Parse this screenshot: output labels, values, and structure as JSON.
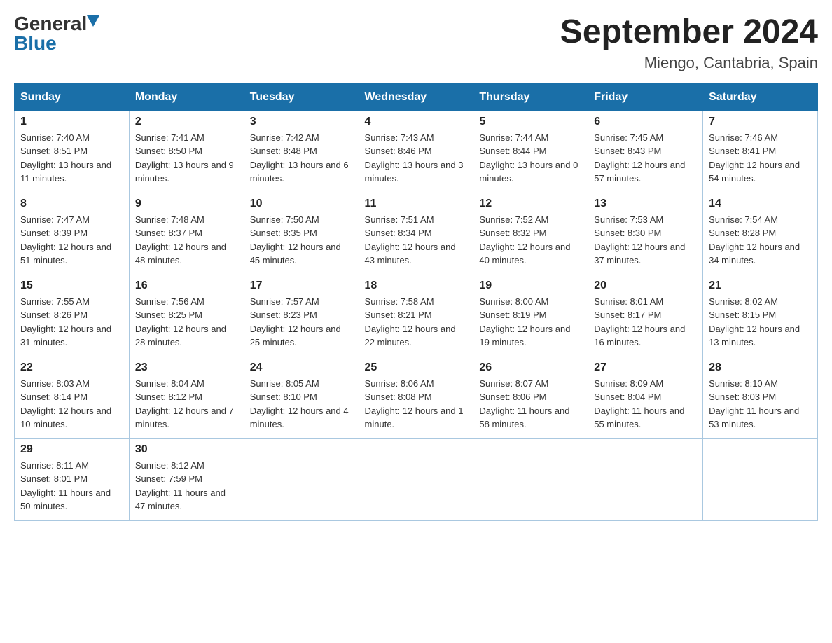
{
  "header": {
    "logo": {
      "general": "General",
      "blue": "Blue",
      "aria": "GeneralBlue logo"
    },
    "title": "September 2024",
    "location": "Miengo, Cantabria, Spain"
  },
  "calendar": {
    "days_of_week": [
      "Sunday",
      "Monday",
      "Tuesday",
      "Wednesday",
      "Thursday",
      "Friday",
      "Saturday"
    ],
    "weeks": [
      [
        {
          "day": "1",
          "sunrise": "7:40 AM",
          "sunset": "8:51 PM",
          "daylight": "13 hours and 11 minutes."
        },
        {
          "day": "2",
          "sunrise": "7:41 AM",
          "sunset": "8:50 PM",
          "daylight": "13 hours and 9 minutes."
        },
        {
          "day": "3",
          "sunrise": "7:42 AM",
          "sunset": "8:48 PM",
          "daylight": "13 hours and 6 minutes."
        },
        {
          "day": "4",
          "sunrise": "7:43 AM",
          "sunset": "8:46 PM",
          "daylight": "13 hours and 3 minutes."
        },
        {
          "day": "5",
          "sunrise": "7:44 AM",
          "sunset": "8:44 PM",
          "daylight": "13 hours and 0 minutes."
        },
        {
          "day": "6",
          "sunrise": "7:45 AM",
          "sunset": "8:43 PM",
          "daylight": "12 hours and 57 minutes."
        },
        {
          "day": "7",
          "sunrise": "7:46 AM",
          "sunset": "8:41 PM",
          "daylight": "12 hours and 54 minutes."
        }
      ],
      [
        {
          "day": "8",
          "sunrise": "7:47 AM",
          "sunset": "8:39 PM",
          "daylight": "12 hours and 51 minutes."
        },
        {
          "day": "9",
          "sunrise": "7:48 AM",
          "sunset": "8:37 PM",
          "daylight": "12 hours and 48 minutes."
        },
        {
          "day": "10",
          "sunrise": "7:50 AM",
          "sunset": "8:35 PM",
          "daylight": "12 hours and 45 minutes."
        },
        {
          "day": "11",
          "sunrise": "7:51 AM",
          "sunset": "8:34 PM",
          "daylight": "12 hours and 43 minutes."
        },
        {
          "day": "12",
          "sunrise": "7:52 AM",
          "sunset": "8:32 PM",
          "daylight": "12 hours and 40 minutes."
        },
        {
          "day": "13",
          "sunrise": "7:53 AM",
          "sunset": "8:30 PM",
          "daylight": "12 hours and 37 minutes."
        },
        {
          "day": "14",
          "sunrise": "7:54 AM",
          "sunset": "8:28 PM",
          "daylight": "12 hours and 34 minutes."
        }
      ],
      [
        {
          "day": "15",
          "sunrise": "7:55 AM",
          "sunset": "8:26 PM",
          "daylight": "12 hours and 31 minutes."
        },
        {
          "day": "16",
          "sunrise": "7:56 AM",
          "sunset": "8:25 PM",
          "daylight": "12 hours and 28 minutes."
        },
        {
          "day": "17",
          "sunrise": "7:57 AM",
          "sunset": "8:23 PM",
          "daylight": "12 hours and 25 minutes."
        },
        {
          "day": "18",
          "sunrise": "7:58 AM",
          "sunset": "8:21 PM",
          "daylight": "12 hours and 22 minutes."
        },
        {
          "day": "19",
          "sunrise": "8:00 AM",
          "sunset": "8:19 PM",
          "daylight": "12 hours and 19 minutes."
        },
        {
          "day": "20",
          "sunrise": "8:01 AM",
          "sunset": "8:17 PM",
          "daylight": "12 hours and 16 minutes."
        },
        {
          "day": "21",
          "sunrise": "8:02 AM",
          "sunset": "8:15 PM",
          "daylight": "12 hours and 13 minutes."
        }
      ],
      [
        {
          "day": "22",
          "sunrise": "8:03 AM",
          "sunset": "8:14 PM",
          "daylight": "12 hours and 10 minutes."
        },
        {
          "day": "23",
          "sunrise": "8:04 AM",
          "sunset": "8:12 PM",
          "daylight": "12 hours and 7 minutes."
        },
        {
          "day": "24",
          "sunrise": "8:05 AM",
          "sunset": "8:10 PM",
          "daylight": "12 hours and 4 minutes."
        },
        {
          "day": "25",
          "sunrise": "8:06 AM",
          "sunset": "8:08 PM",
          "daylight": "12 hours and 1 minute."
        },
        {
          "day": "26",
          "sunrise": "8:07 AM",
          "sunset": "8:06 PM",
          "daylight": "11 hours and 58 minutes."
        },
        {
          "day": "27",
          "sunrise": "8:09 AM",
          "sunset": "8:04 PM",
          "daylight": "11 hours and 55 minutes."
        },
        {
          "day": "28",
          "sunrise": "8:10 AM",
          "sunset": "8:03 PM",
          "daylight": "11 hours and 53 minutes."
        }
      ],
      [
        {
          "day": "29",
          "sunrise": "8:11 AM",
          "sunset": "8:01 PM",
          "daylight": "11 hours and 50 minutes."
        },
        {
          "day": "30",
          "sunrise": "8:12 AM",
          "sunset": "7:59 PM",
          "daylight": "11 hours and 47 minutes."
        },
        null,
        null,
        null,
        null,
        null
      ]
    ]
  }
}
